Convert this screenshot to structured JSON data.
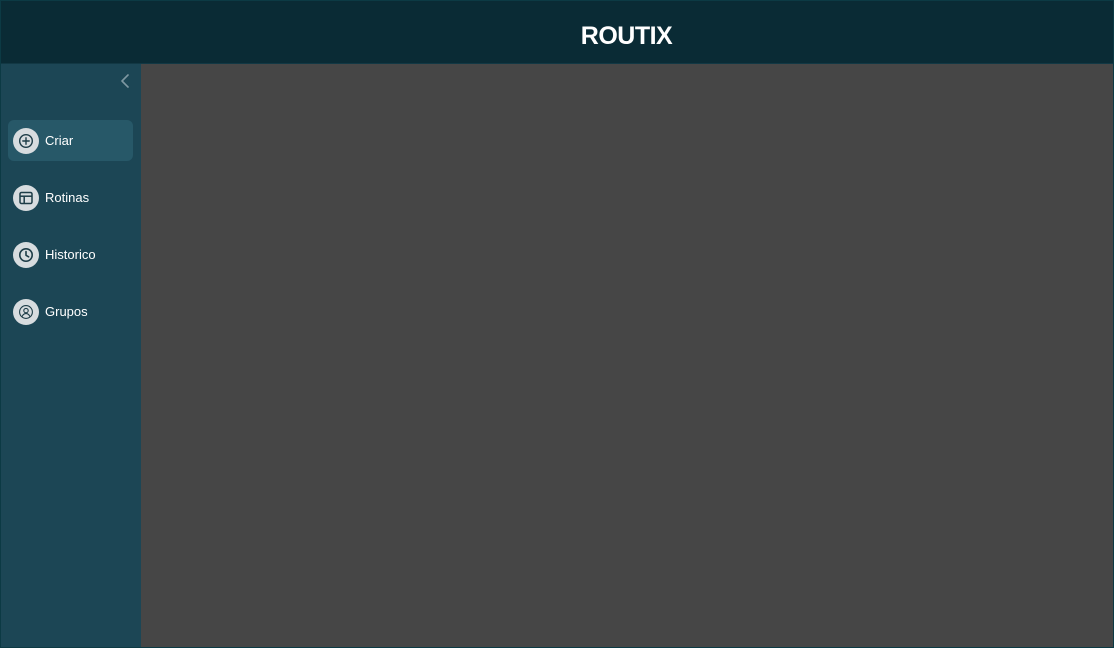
{
  "header": {
    "title": "ROUTIX"
  },
  "sidebar": {
    "collapse_icon": "chevron-left-icon",
    "items": [
      {
        "label": "Criar",
        "icon": "plus-circle-icon",
        "active": true
      },
      {
        "label": "Rotinas",
        "icon": "table-layout-icon",
        "active": false
      },
      {
        "label": "Historico",
        "icon": "clock-icon",
        "active": false
      },
      {
        "label": "Grupos",
        "icon": "user-circle-icon",
        "active": false
      }
    ]
  },
  "colors": {
    "header_bg": "#0a2b35",
    "sidebar_bg": "#1c4655",
    "sidebar_active_bg": "#275868",
    "main_bg": "#464646",
    "icon_bg": "#d7dcdf",
    "text": "#ffffff"
  }
}
